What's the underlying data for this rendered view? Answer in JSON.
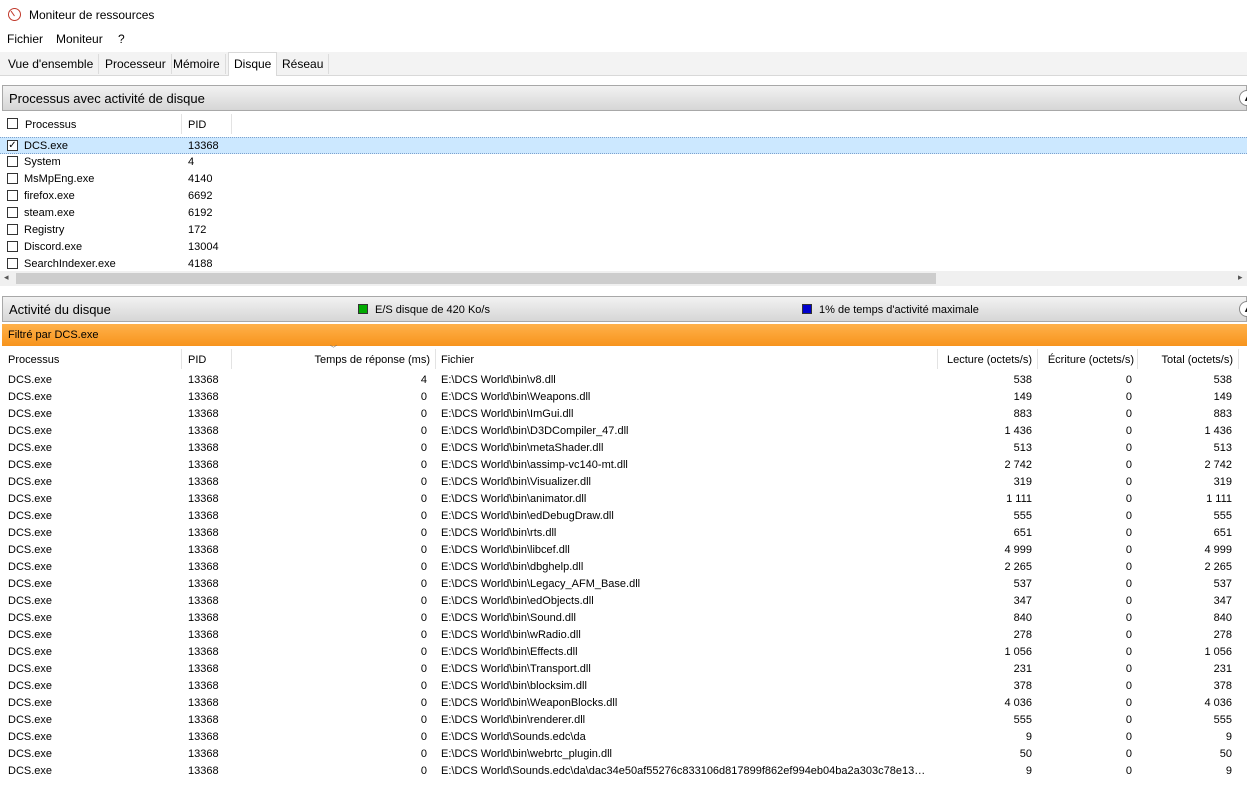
{
  "window": {
    "title": "Moniteur de ressources",
    "icon": "resource-monitor-icon"
  },
  "menu": [
    "Fichier",
    "Moniteur",
    "?"
  ],
  "tabs": [
    "Vue d'ensemble",
    "Processeur",
    "Mémoire",
    "Disque",
    "Réseau"
  ],
  "active_tab": "Disque",
  "processes_section": {
    "title": "Processus avec activité de disque",
    "columns": [
      "Processus",
      "PID"
    ],
    "rows": [
      {
        "name": "DCS.exe",
        "pid": "13368",
        "checked": true
      },
      {
        "name": "System",
        "pid": "4",
        "checked": false
      },
      {
        "name": "MsMpEng.exe",
        "pid": "4140",
        "checked": false
      },
      {
        "name": "firefox.exe",
        "pid": "6692",
        "checked": false
      },
      {
        "name": "steam.exe",
        "pid": "6192",
        "checked": false
      },
      {
        "name": "Registry",
        "pid": "172",
        "checked": false
      },
      {
        "name": "Discord.exe",
        "pid": "13004",
        "checked": false
      },
      {
        "name": "SearchIndexer.exe",
        "pid": "4188",
        "checked": false
      }
    ]
  },
  "activity_section": {
    "title": "Activité du disque",
    "io_legend": "E/S disque de 420 Ko/s",
    "io_color": "#00aa00",
    "active_time_legend": "1% de temps d'activité maximale",
    "active_time_color": "#0000cc",
    "filter_text": "Filtré par DCS.exe",
    "columns": [
      "Processus",
      "PID",
      "Temps de réponse (ms)",
      "Fichier",
      "Lecture (octets/s)",
      "Écriture (octets/s)",
      "Total (octets/s)"
    ],
    "rows": [
      {
        "proc": "DCS.exe",
        "pid": "13368",
        "resp": "4",
        "file": "E:\\DCS World\\bin\\v8.dll",
        "read": "538",
        "write": "0",
        "total": "538"
      },
      {
        "proc": "DCS.exe",
        "pid": "13368",
        "resp": "0",
        "file": "E:\\DCS World\\bin\\Weapons.dll",
        "read": "149",
        "write": "0",
        "total": "149"
      },
      {
        "proc": "DCS.exe",
        "pid": "13368",
        "resp": "0",
        "file": "E:\\DCS World\\bin\\ImGui.dll",
        "read": "883",
        "write": "0",
        "total": "883"
      },
      {
        "proc": "DCS.exe",
        "pid": "13368",
        "resp": "0",
        "file": "E:\\DCS World\\bin\\D3DCompiler_47.dll",
        "read": "1 436",
        "write": "0",
        "total": "1 436"
      },
      {
        "proc": "DCS.exe",
        "pid": "13368",
        "resp": "0",
        "file": "E:\\DCS World\\bin\\metaShader.dll",
        "read": "513",
        "write": "0",
        "total": "513"
      },
      {
        "proc": "DCS.exe",
        "pid": "13368",
        "resp": "0",
        "file": "E:\\DCS World\\bin\\assimp-vc140-mt.dll",
        "read": "2 742",
        "write": "0",
        "total": "2 742"
      },
      {
        "proc": "DCS.exe",
        "pid": "13368",
        "resp": "0",
        "file": "E:\\DCS World\\bin\\Visualizer.dll",
        "read": "319",
        "write": "0",
        "total": "319"
      },
      {
        "proc": "DCS.exe",
        "pid": "13368",
        "resp": "0",
        "file": "E:\\DCS World\\bin\\animator.dll",
        "read": "1 111",
        "write": "0",
        "total": "1 111"
      },
      {
        "proc": "DCS.exe",
        "pid": "13368",
        "resp": "0",
        "file": "E:\\DCS World\\bin\\edDebugDraw.dll",
        "read": "555",
        "write": "0",
        "total": "555"
      },
      {
        "proc": "DCS.exe",
        "pid": "13368",
        "resp": "0",
        "file": "E:\\DCS World\\bin\\rts.dll",
        "read": "651",
        "write": "0",
        "total": "651"
      },
      {
        "proc": "DCS.exe",
        "pid": "13368",
        "resp": "0",
        "file": "E:\\DCS World\\bin\\libcef.dll",
        "read": "4 999",
        "write": "0",
        "total": "4 999"
      },
      {
        "proc": "DCS.exe",
        "pid": "13368",
        "resp": "0",
        "file": "E:\\DCS World\\bin\\dbghelp.dll",
        "read": "2 265",
        "write": "0",
        "total": "2 265"
      },
      {
        "proc": "DCS.exe",
        "pid": "13368",
        "resp": "0",
        "file": "E:\\DCS World\\bin\\Legacy_AFM_Base.dll",
        "read": "537",
        "write": "0",
        "total": "537"
      },
      {
        "proc": "DCS.exe",
        "pid": "13368",
        "resp": "0",
        "file": "E:\\DCS World\\bin\\edObjects.dll",
        "read": "347",
        "write": "0",
        "total": "347"
      },
      {
        "proc": "DCS.exe",
        "pid": "13368",
        "resp": "0",
        "file": "E:\\DCS World\\bin\\Sound.dll",
        "read": "840",
        "write": "0",
        "total": "840"
      },
      {
        "proc": "DCS.exe",
        "pid": "13368",
        "resp": "0",
        "file": "E:\\DCS World\\bin\\wRadio.dll",
        "read": "278",
        "write": "0",
        "total": "278"
      },
      {
        "proc": "DCS.exe",
        "pid": "13368",
        "resp": "0",
        "file": "E:\\DCS World\\bin\\Effects.dll",
        "read": "1 056",
        "write": "0",
        "total": "1 056"
      },
      {
        "proc": "DCS.exe",
        "pid": "13368",
        "resp": "0",
        "file": "E:\\DCS World\\bin\\Transport.dll",
        "read": "231",
        "write": "0",
        "total": "231"
      },
      {
        "proc": "DCS.exe",
        "pid": "13368",
        "resp": "0",
        "file": "E:\\DCS World\\bin\\blocksim.dll",
        "read": "378",
        "write": "0",
        "total": "378"
      },
      {
        "proc": "DCS.exe",
        "pid": "13368",
        "resp": "0",
        "file": "E:\\DCS World\\bin\\WeaponBlocks.dll",
        "read": "4 036",
        "write": "0",
        "total": "4 036"
      },
      {
        "proc": "DCS.exe",
        "pid": "13368",
        "resp": "0",
        "file": "E:\\DCS World\\bin\\renderer.dll",
        "read": "555",
        "write": "0",
        "total": "555"
      },
      {
        "proc": "DCS.exe",
        "pid": "13368",
        "resp": "0",
        "file": "E:\\DCS World\\Sounds.edc\\da",
        "read": "9",
        "write": "0",
        "total": "9"
      },
      {
        "proc": "DCS.exe",
        "pid": "13368",
        "resp": "0",
        "file": "E:\\DCS World\\bin\\webrtc_plugin.dll",
        "read": "50",
        "write": "0",
        "total": "50"
      },
      {
        "proc": "DCS.exe",
        "pid": "13368",
        "resp": "0",
        "file": "E:\\DCS World\\Sounds.edc\\da\\dac34e50af55276c833106d817899f862ef994eb04ba2a303c78e13…",
        "read": "9",
        "write": "0",
        "total": "9"
      }
    ]
  }
}
